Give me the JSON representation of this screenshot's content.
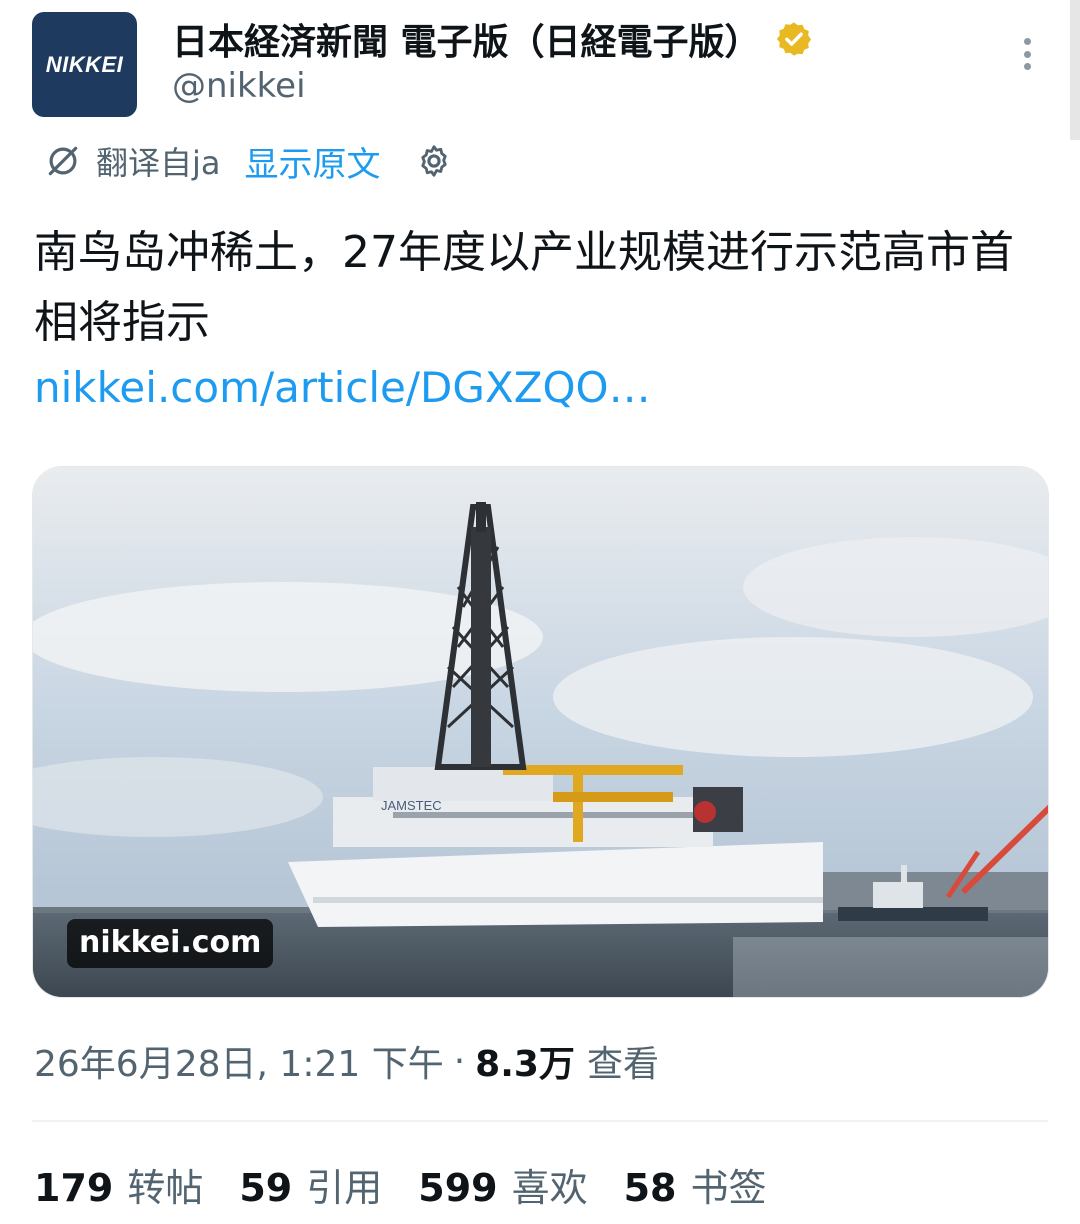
{
  "account": {
    "avatar_text": "NIKKEI",
    "display_name": "日本経済新聞 電子版（日経電子版）",
    "handle": "@nikkei"
  },
  "translation": {
    "label": "翻译自ja",
    "show_original": "显示原文"
  },
  "tweet": {
    "text": "南鸟岛冲稀土，27年度以产业规模进行示范高市首相将指示",
    "link": "nikkei.com/article/DGXZQO…"
  },
  "media": {
    "domain_label": "nikkei.com",
    "hull_text": "JAMSTEC"
  },
  "meta": {
    "timestamp": "26年6月28日, 1:21 下午",
    "separator": "·",
    "views_count": "8.3万",
    "views_label": "查看"
  },
  "stats": [
    {
      "count": "179",
      "label": "转帖"
    },
    {
      "count": "59",
      "label": "引用"
    },
    {
      "count": "599",
      "label": "喜欢"
    },
    {
      "count": "58",
      "label": "书签"
    }
  ],
  "colors": {
    "accent": "#1d9bf0",
    "muted": "#536471",
    "verified": "#e8b923",
    "avatar_bg": "#1f3a5f"
  },
  "icons": {
    "verified": "verified-badge-icon",
    "translate": "translate-icon",
    "settings": "gear-icon",
    "more": "more-vertical-icon"
  }
}
